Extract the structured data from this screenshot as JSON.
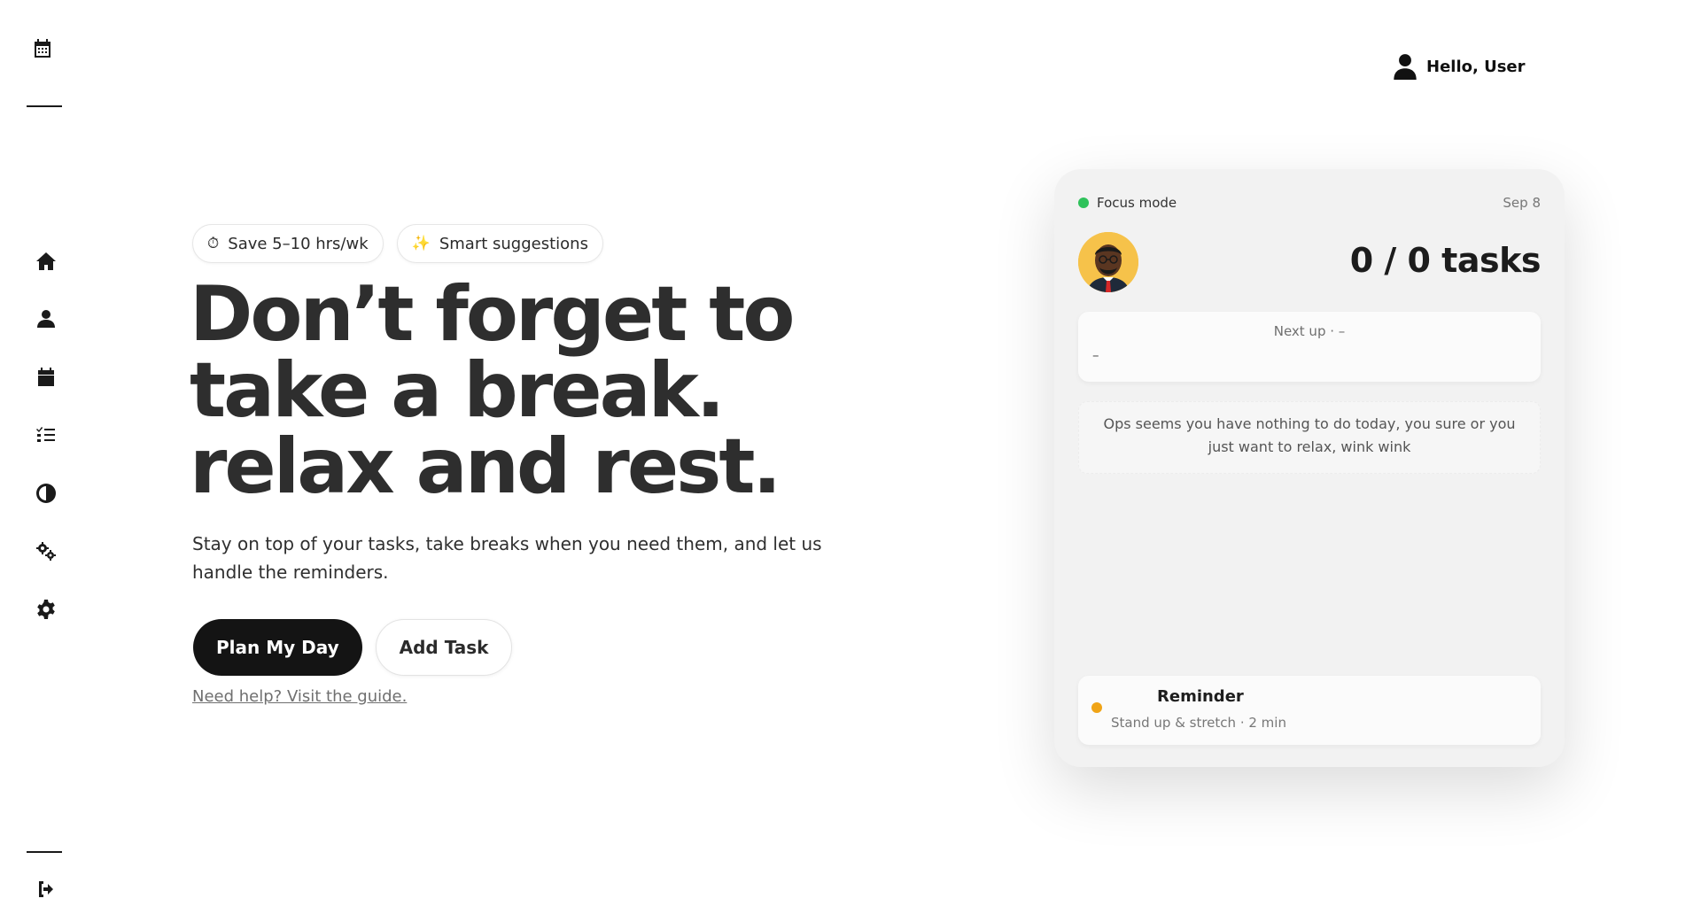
{
  "greeting": "Hello, User",
  "chips": [
    {
      "icon": "stopwatch-icon",
      "glyph": "⏱",
      "label": "Save 5–10 hrs/wk"
    },
    {
      "icon": "sparkles-icon",
      "glyph": "✨",
      "label": "Smart suggestions"
    }
  ],
  "hero": {
    "title_lines": [
      "Don’t forget to",
      "take a break.",
      "relax and rest."
    ],
    "subtitle": "Stay on top of your tasks, take breaks when you need them, and let us handle the reminders.",
    "primary_button": "Plan My Day",
    "secondary_button": "Add Task",
    "help_link": "Need help? Visit the guide."
  },
  "card": {
    "mode_label": "Focus mode",
    "date": "Sep 8",
    "tasks_count": "0 / 0 tasks",
    "next_up_label": "Next up · –",
    "next_up_value": "–",
    "empty_message": "Ops seems you have nothing to do today, you sure or you just want to relax, wink wink",
    "reminder_title": "Reminder",
    "reminder_detail": "Stand up & stretch · 2 min"
  },
  "colors": {
    "focus_dot": "#2fc25b",
    "reminder_dot": "#f0a416",
    "primary_button": "#141414",
    "avatar_bg": "#f6c24a"
  },
  "sidebar_icons": [
    "calendar-grid-icon",
    "home-icon",
    "user-icon",
    "calendar-icon",
    "task-list-icon",
    "contrast-icon",
    "gears-icon",
    "settings-icon",
    "logout-icon"
  ]
}
